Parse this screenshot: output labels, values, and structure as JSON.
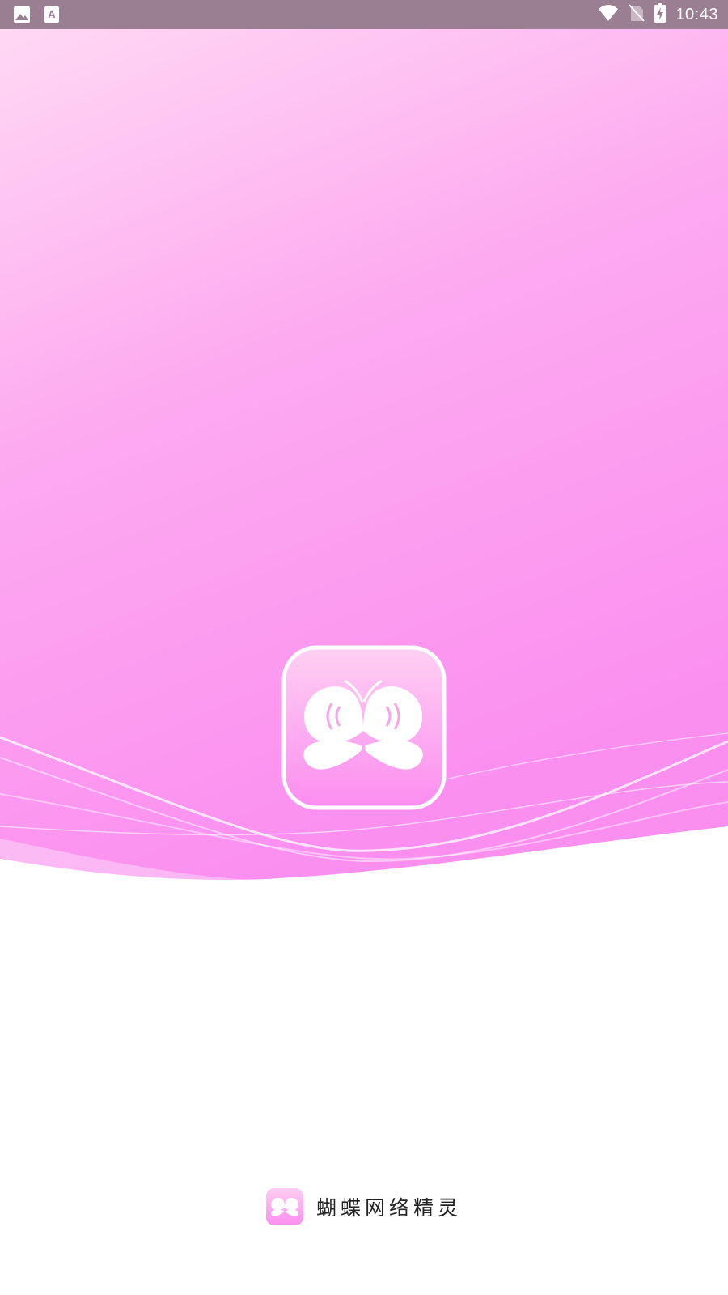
{
  "status_bar": {
    "time": "10:43",
    "left_icons": [
      "image-notification-icon",
      "text-notification-icon"
    ],
    "right_icons": [
      "wifi-icon",
      "no-sim-icon",
      "battery-charging-icon"
    ]
  },
  "app": {
    "name": "蝴蝶网络精灵",
    "logo_icon": "butterfly-icon"
  },
  "colors": {
    "status_bar_bg": "#9a7f93",
    "gradient_top": "#ffd6f3",
    "gradient_mid": "#fca6ef",
    "gradient_bottom": "#fb8ef0",
    "background": "#ffffff"
  }
}
